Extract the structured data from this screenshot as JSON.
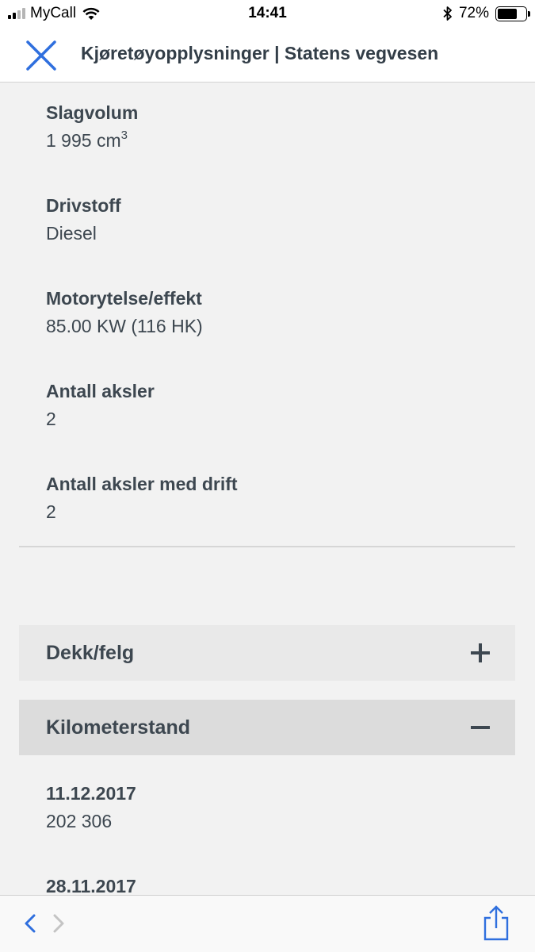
{
  "status_bar": {
    "carrier": "MyCall",
    "time": "14:41",
    "battery": "72%",
    "battery_level": 0.72
  },
  "nav": {
    "title": "Kjøretøyopplysninger | Statens vegvesen",
    "close_icon": "close-icon"
  },
  "fields": [
    {
      "label": "Slagvolum",
      "value": "1 995 cm",
      "unit_sup": "3"
    },
    {
      "label": "Drivstoff",
      "value": "Diesel"
    },
    {
      "label": "Motorytelse/effekt",
      "value": "85.00 KW (116 HK)"
    },
    {
      "label": "Antall aksler",
      "value": "2"
    },
    {
      "label": "Antall aksler med drift",
      "value": "2"
    }
  ],
  "sections": [
    {
      "title": "Dekk/felg",
      "state": "collapsed",
      "icon": "plus-icon"
    },
    {
      "title": "Kilometerstand",
      "state": "expanded",
      "icon": "minus-icon"
    }
  ],
  "odometer": [
    {
      "date": "11.12.2017",
      "value": "202 306"
    },
    {
      "date": "28.11.2017",
      "value": ""
    }
  ],
  "toolbar": {
    "back_icon": "back-icon",
    "forward_icon": "forward-icon",
    "share_icon": "share-icon"
  },
  "colors": {
    "accent": "#2f6fde",
    "text": "#3d4750",
    "background": "#f2f2f2"
  }
}
